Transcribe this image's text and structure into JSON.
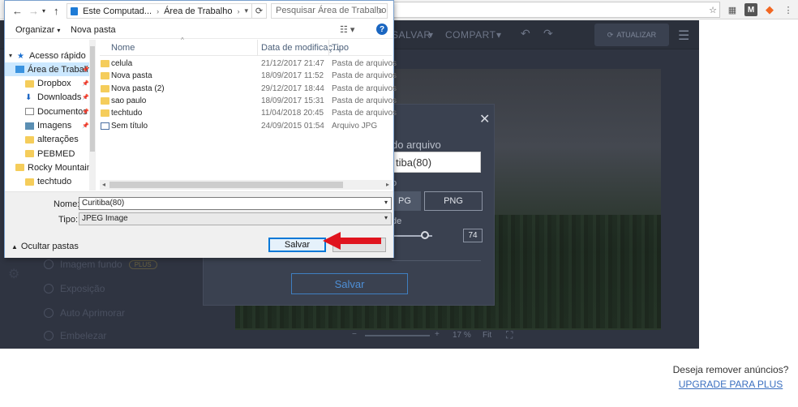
{
  "browser": {
    "star_icon": "☆",
    "ext_m": "M",
    "menu_icon": "⋮"
  },
  "app": {
    "menu_save": "SALVAR",
    "menu_share": "COMPART",
    "update_button": "ATUALIZAR",
    "sidebar": [
      {
        "label": "Imagem fundo",
        "badge": "PLUS"
      },
      {
        "label": "Exposição"
      },
      {
        "label": "Auto Aprimorar"
      },
      {
        "label": "Embelezar"
      }
    ],
    "zoom_value": "17 %",
    "fit_label": "Fit",
    "accent": "#3f7fc1"
  },
  "save_modal": {
    "filename_label": "do arquivo",
    "filename_value": "tiba(80)",
    "format_label": "o",
    "format_jpg": "PG",
    "format_png": "PNG",
    "quality_label": "de",
    "quality_value": "74",
    "quality_fraction": 0.74,
    "save_button": "Salvar"
  },
  "ad": {
    "text": "Deseja remover anúncios?",
    "link": "UPGRADE PARA PLUS"
  },
  "dialog": {
    "breadcrumb": [
      "Este Computad...",
      "Área de Trabalho"
    ],
    "search_placeholder": "Pesquisar Área de Trabalho",
    "organize": "Organizar",
    "new_folder": "Nova pasta",
    "nav_items": [
      {
        "label": "Acesso rápido",
        "icon": "star-icon",
        "level": 0
      },
      {
        "label": "Área de Trabalho",
        "icon": "desktop-icon",
        "level": 1,
        "selected": true,
        "pinned": true
      },
      {
        "label": "Dropbox",
        "icon": "folder-icon",
        "level": 1,
        "pinned": true
      },
      {
        "label": "Downloads",
        "icon": "download-icon",
        "level": 1,
        "pinned": true
      },
      {
        "label": "Documentos",
        "icon": "documents-icon",
        "level": 1,
        "pinned": true
      },
      {
        "label": "Imagens",
        "icon": "images-icon",
        "level": 1,
        "pinned": true
      },
      {
        "label": "alterações",
        "icon": "folder-icon",
        "level": 1
      },
      {
        "label": "PEBMED",
        "icon": "folder-icon",
        "level": 1
      },
      {
        "label": "Rocky Mountain",
        "icon": "folder-icon",
        "level": 1
      },
      {
        "label": "techtudo",
        "icon": "folder-icon",
        "level": 1
      }
    ],
    "columns": [
      "Nome",
      "Data de modificaç...",
      "Tipo"
    ],
    "files": [
      {
        "name": "celula",
        "date": "21/12/2017 21:47",
        "type": "Pasta de arquivos",
        "kind": "folder"
      },
      {
        "name": "Nova pasta",
        "date": "18/09/2017 11:52",
        "type": "Pasta de arquivos",
        "kind": "folder"
      },
      {
        "name": "Nova pasta (2)",
        "date": "29/12/2017 18:44",
        "type": "Pasta de arquivos",
        "kind": "folder"
      },
      {
        "name": "sao paulo",
        "date": "18/09/2017 15:31",
        "type": "Pasta de arquivos",
        "kind": "folder"
      },
      {
        "name": "techtudo",
        "date": "11/04/2018 20:45",
        "type": "Pasta de arquivos",
        "kind": "folder"
      },
      {
        "name": "Sem título",
        "date": "24/09/2015 01:54",
        "type": "Arquivo JPG",
        "kind": "jpg"
      }
    ],
    "name_label": "Nome:",
    "name_value": "Curitiba(80)",
    "type_label": "Tipo:",
    "type_value": "JPEG Image",
    "hide_folders": "Ocultar pastas",
    "save_button": "Salvar",
    "arrow_color": "#e0141e"
  }
}
